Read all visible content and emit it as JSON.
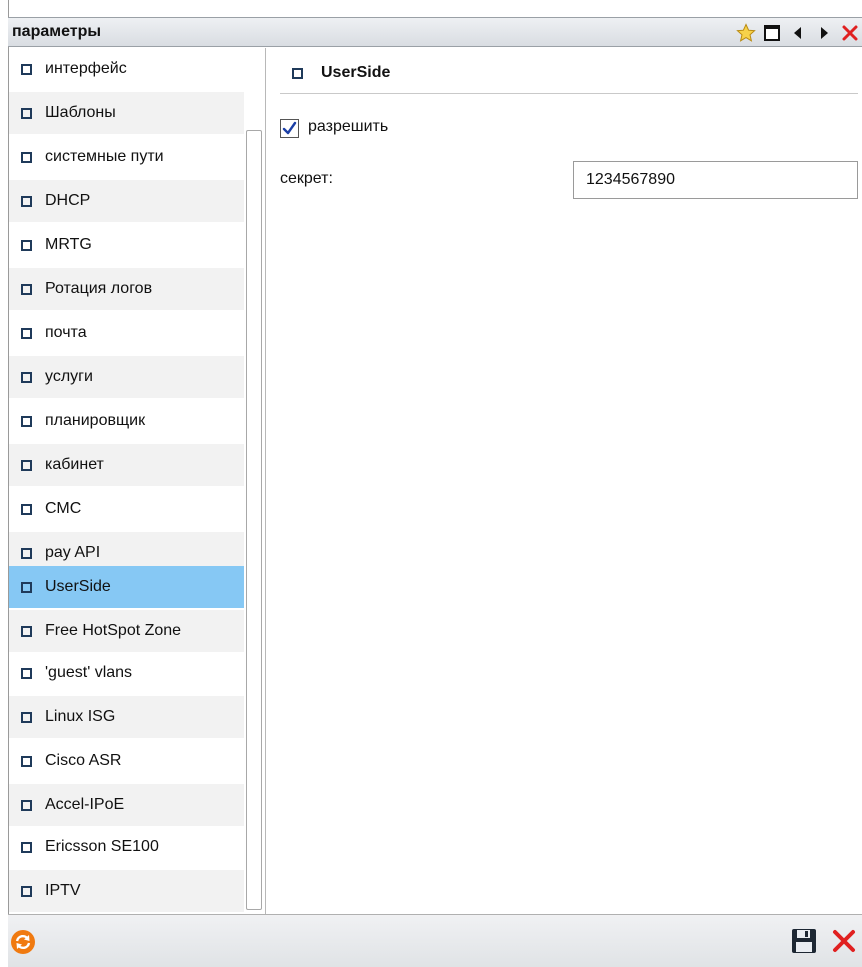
{
  "window": {
    "title": "параметры",
    "icons": [
      "star-icon",
      "maximize-icon",
      "arrow-left-icon",
      "arrow-right-icon",
      "close-icon"
    ]
  },
  "sidebar": {
    "selected": "UserSide",
    "items": [
      {
        "label": "интерфейс"
      },
      {
        "label": "Шаблоны"
      },
      {
        "label": "системные пути"
      },
      {
        "label": "DHCP"
      },
      {
        "label": "MRTG"
      },
      {
        "label": "Ротация логов"
      },
      {
        "label": "почта"
      },
      {
        "label": "услуги"
      },
      {
        "label": "планировщик"
      },
      {
        "label": "кабинет"
      },
      {
        "label": "СМС"
      },
      {
        "label": "pay API"
      },
      {
        "label": "UserSide"
      },
      {
        "label": "Free HotSpot Zone"
      },
      {
        "label": "'guest' vlans"
      },
      {
        "label": "Linux ISG"
      },
      {
        "label": "Cisco ASR"
      },
      {
        "label": "Accel-IPoE"
      },
      {
        "label": "Ericsson SE100"
      },
      {
        "label": "IPTV"
      }
    ]
  },
  "content": {
    "section_title": "UserSide",
    "enable_label": "разрешить",
    "enable_checked": true,
    "secret_label": "секрет:",
    "secret_value": "1234567890"
  },
  "footer": {
    "icons": [
      "refresh-icon",
      "save-icon",
      "cancel-icon"
    ]
  },
  "colors": {
    "selection": "#86c8f4",
    "bullet": "#1f3a5a",
    "star": "#f3c12a",
    "close": "#e02020",
    "refresh": "#f07a10"
  }
}
